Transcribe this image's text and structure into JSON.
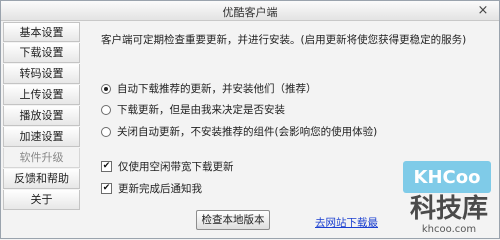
{
  "window": {
    "title": "优酷客户端",
    "close_label": "×"
  },
  "sidebar": {
    "items": [
      {
        "label": "基本设置",
        "active": false
      },
      {
        "label": "下载设置",
        "active": false
      },
      {
        "label": "转码设置",
        "active": false
      },
      {
        "label": "上传设置",
        "active": false
      },
      {
        "label": "播放设置",
        "active": false
      },
      {
        "label": "加速设置",
        "active": false
      },
      {
        "label": "软件升级",
        "active": true
      },
      {
        "label": "反馈和帮助",
        "active": false
      },
      {
        "label": "关于",
        "active": false
      }
    ]
  },
  "main": {
    "description": "客户端可定期检查重要更新，并进行安装。(启用更新将使您获得更稳定的服务)",
    "update_options": [
      {
        "label": "自动下载推荐的更新，并安装他们（推荐）",
        "selected": true
      },
      {
        "label": "下载更新，但是由我来决定是否安装",
        "selected": false
      },
      {
        "label": "关闭自动更新，不安装推荐的组件(会影响您的使用体验)",
        "selected": false
      }
    ],
    "checkboxes": [
      {
        "label": "仅使用空闲带宽下载更新",
        "checked": true
      },
      {
        "label": "更新完成后通知我",
        "checked": true
      }
    ],
    "check_version_button": "检查本地版本",
    "official_download_link": "去网站下载最"
  },
  "watermark": {
    "logo_text": "KHCoo",
    "cn_text": "科技库",
    "url_text": "khcoo.com"
  },
  "colors": {
    "link": "#1a3fd0",
    "watermark_bg": "#7fcbe8"
  }
}
